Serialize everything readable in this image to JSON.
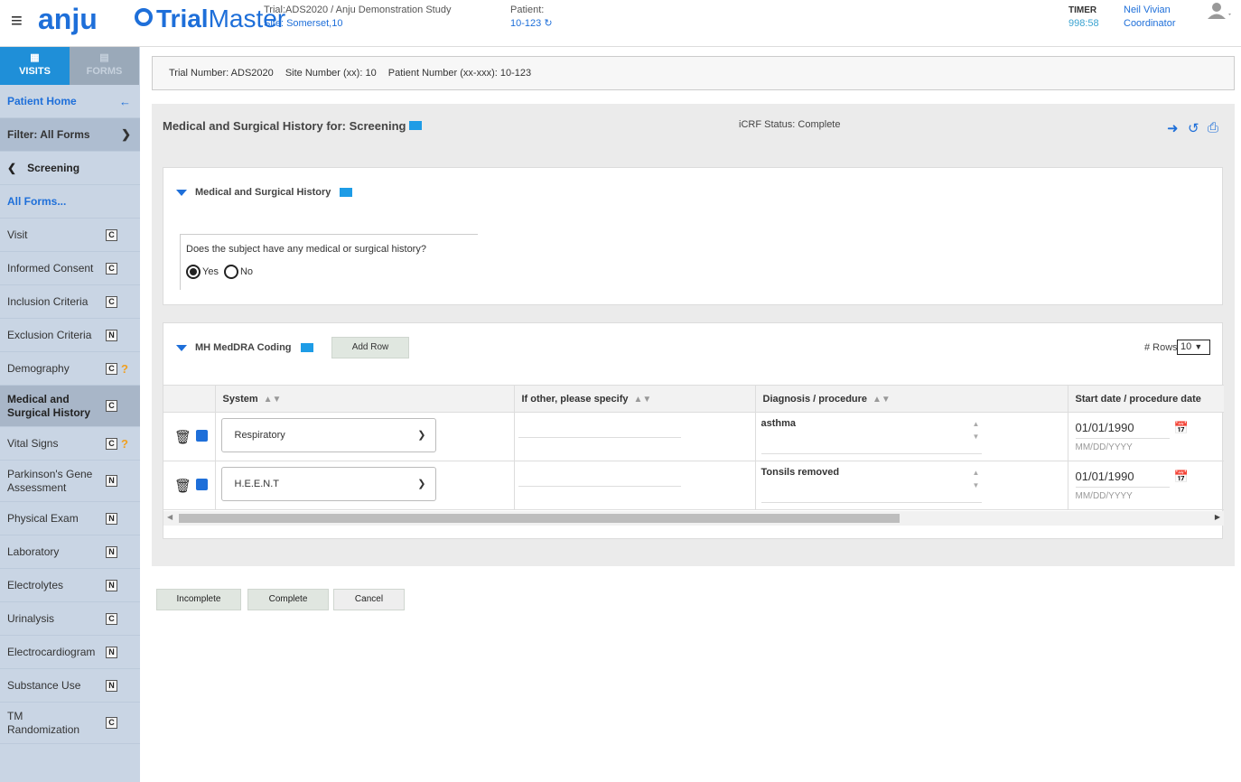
{
  "header": {
    "menu_icon": "hamburger-icon",
    "logo_anju": "anju",
    "logo_trial": "Trial",
    "logo_master": "Master",
    "trial_line": "Trial:ADS2020 / Anju Demonstration Study",
    "site_line": "Site: Somerset,10",
    "patient_label": "Patient:",
    "patient_value": "10-123",
    "refresh_icon": "refresh-icon",
    "timer_label": "TIMER",
    "timer_value": "998:58",
    "user_name": "Neil Vivian",
    "user_role": "Coordinator",
    "avatar_icon": "user-avatar-icon",
    "accent_color": "#1e6fd9"
  },
  "sidebar": {
    "tabs": [
      {
        "label": "VISITS",
        "icon": "calendar-icon"
      },
      {
        "label": "FORMS",
        "icon": "list-icon"
      }
    ],
    "patient_home": "Patient Home",
    "filter": "Filter: All Forms",
    "screening": "Screening",
    "all_forms": "All Forms...",
    "items": [
      {
        "label": "Visit",
        "badge": "C",
        "flag": ""
      },
      {
        "label": "Informed Consent",
        "badge": "C",
        "flag": ""
      },
      {
        "label": "Inclusion Criteria",
        "badge": "C",
        "flag": ""
      },
      {
        "label": "Exclusion Criteria",
        "badge": "N",
        "flag": ""
      },
      {
        "label": "Demography",
        "badge": "C",
        "flag": "?"
      },
      {
        "label": "Medical and Surgical History",
        "badge": "C",
        "flag": ""
      },
      {
        "label": "Vital Signs",
        "badge": "C",
        "flag": "?"
      },
      {
        "label": "Parkinson's Gene Assessment",
        "badge": "N",
        "flag": ""
      },
      {
        "label": "Physical Exam",
        "badge": "N",
        "flag": ""
      },
      {
        "label": "Laboratory",
        "badge": "N",
        "flag": ""
      },
      {
        "label": "Electrolytes",
        "badge": "N",
        "flag": ""
      },
      {
        "label": "Urinalysis",
        "badge": "C",
        "flag": ""
      },
      {
        "label": "Electrocardiogram",
        "badge": "N",
        "flag": ""
      },
      {
        "label": "Substance Use",
        "badge": "N",
        "flag": ""
      },
      {
        "label": "TM Randomization",
        "badge": "C",
        "flag": ""
      }
    ]
  },
  "info_bar": {
    "trial_number": "Trial Number: ADS2020",
    "site_number": "Site Number (xx): 10",
    "patient_number": "Patient Number (xx-xxx): 10-123"
  },
  "form": {
    "title": "Medical and Surgical History for: Screening",
    "status": "iCRF Status: Complete",
    "toolbar_icons": [
      "export-icon",
      "history-icon",
      "print-icon"
    ],
    "section1": {
      "title": "Medical and Surgical History",
      "question": "Does the subject have any medical or surgical history?",
      "yes_label": "Yes",
      "no_label": "No",
      "selected": "Yes"
    },
    "section2": {
      "title": "MH MedDRA Coding",
      "add_row": "Add Row",
      "rows_label": "# Rows",
      "rows_value": "10",
      "columns": [
        "System",
        "If other, please specify",
        "Diagnosis / procedure",
        "Start date / procedure date"
      ],
      "rows": [
        {
          "system": "Respiratory",
          "other": "",
          "diagnosis": "asthma",
          "date": "01/01/1990",
          "date_placeholder": "MM/DD/YYYY"
        },
        {
          "system": "H.E.E.N.T",
          "other": "",
          "diagnosis": "Tonsils removed",
          "date": "01/01/1990",
          "date_placeholder": "MM/DD/YYYY"
        }
      ]
    }
  },
  "actions": {
    "incomplete": "Incomplete",
    "complete": "Complete",
    "cancel": "Cancel"
  }
}
